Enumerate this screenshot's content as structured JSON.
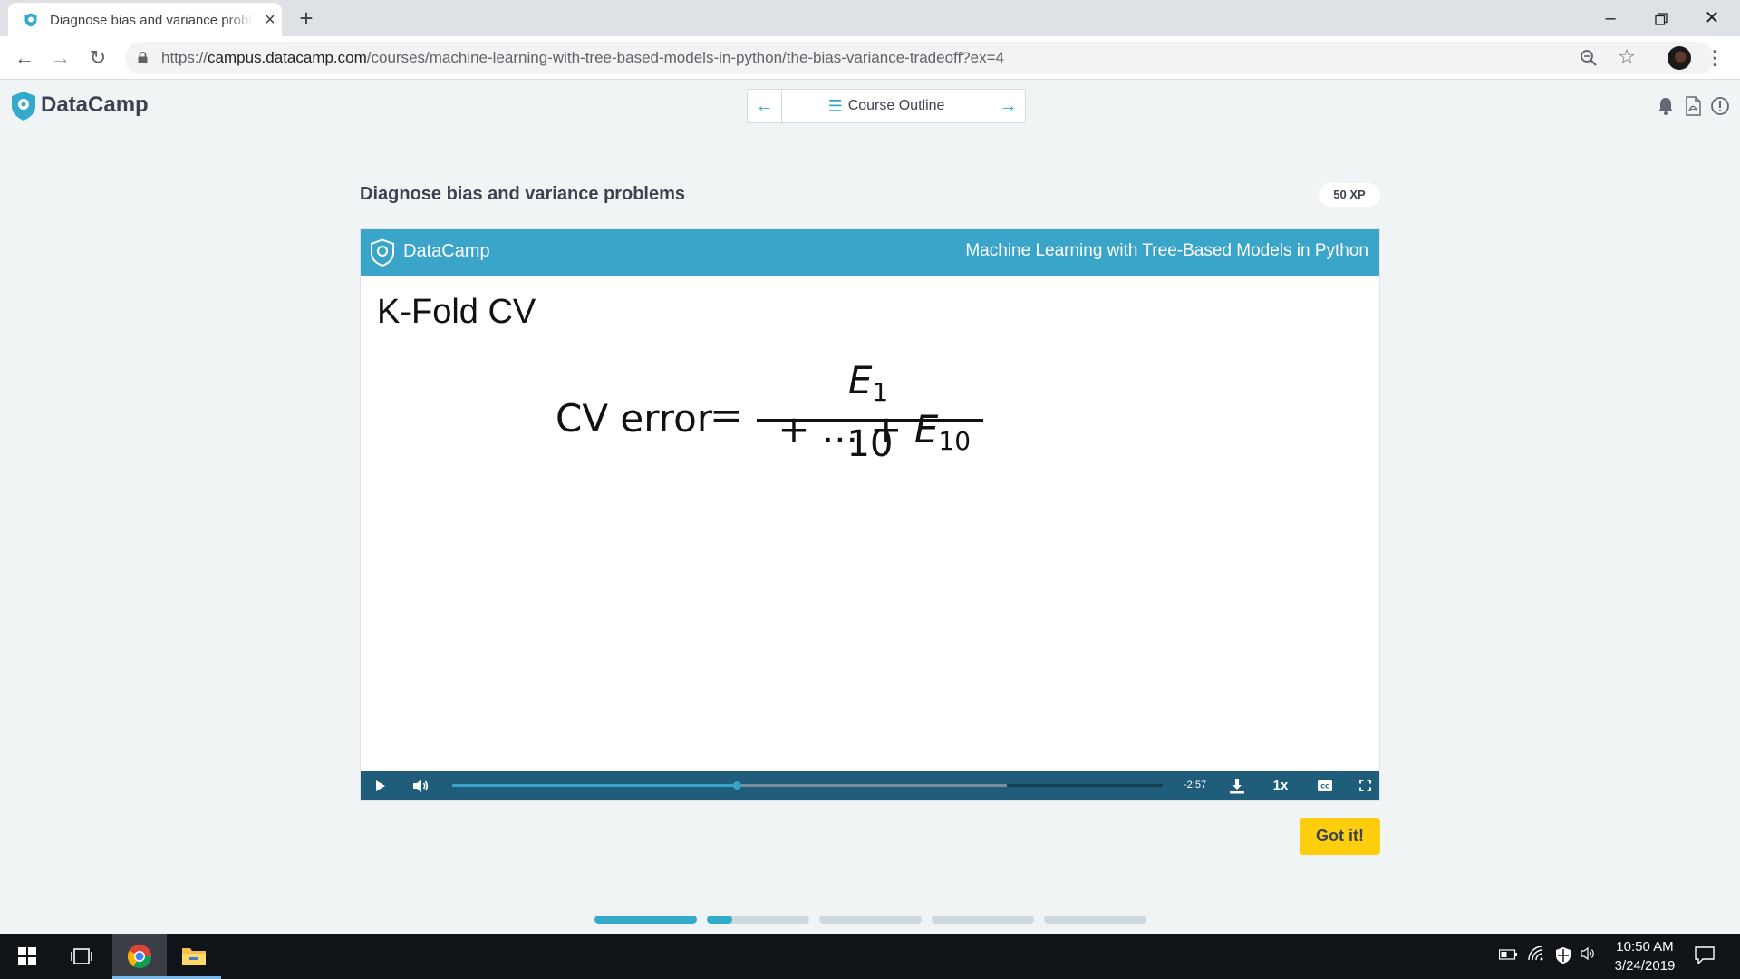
{
  "browser": {
    "tab_title": "Diagnose bias and variance problems",
    "url_scheme": "https://",
    "url_host": "campus.datacamp.com",
    "url_path": "/courses/machine-learning-with-tree-based-models-in-python/the-bias-variance-tradeoff?ex=4",
    "accent_color": "#dee1e6"
  },
  "header": {
    "brand": "DataCamp",
    "course_outline_label": "Course Outline",
    "accent_color": "#33aacc"
  },
  "exercise": {
    "title": "Diagnose bias and variance problems",
    "xp": "50 XP",
    "got_it_label": "Got it!"
  },
  "video": {
    "header_brand": "DataCamp",
    "header_course": "Machine Learning with Tree-Based Models in Python",
    "slide_title": "K-Fold CV",
    "formula": {
      "lhs": "CV error",
      "equals": "=",
      "num_first_var": "E",
      "num_first_sub": "1",
      "num_middle": " + ... + ",
      "num_last_var": "E",
      "num_last_sub": "10",
      "denominator": "10"
    },
    "time_remaining": "-2:57",
    "speed": "1x",
    "progress_played_fraction": 0.4,
    "progress_buffered_fraction": 0.78,
    "header_color": "#3aa4c9",
    "controls_color": "#1f5d7a"
  },
  "steps": {
    "segments": [
      1.0,
      0.25,
      0,
      0,
      0
    ]
  },
  "taskbar": {
    "time": "10:50 AM",
    "date": "3/24/2019"
  }
}
